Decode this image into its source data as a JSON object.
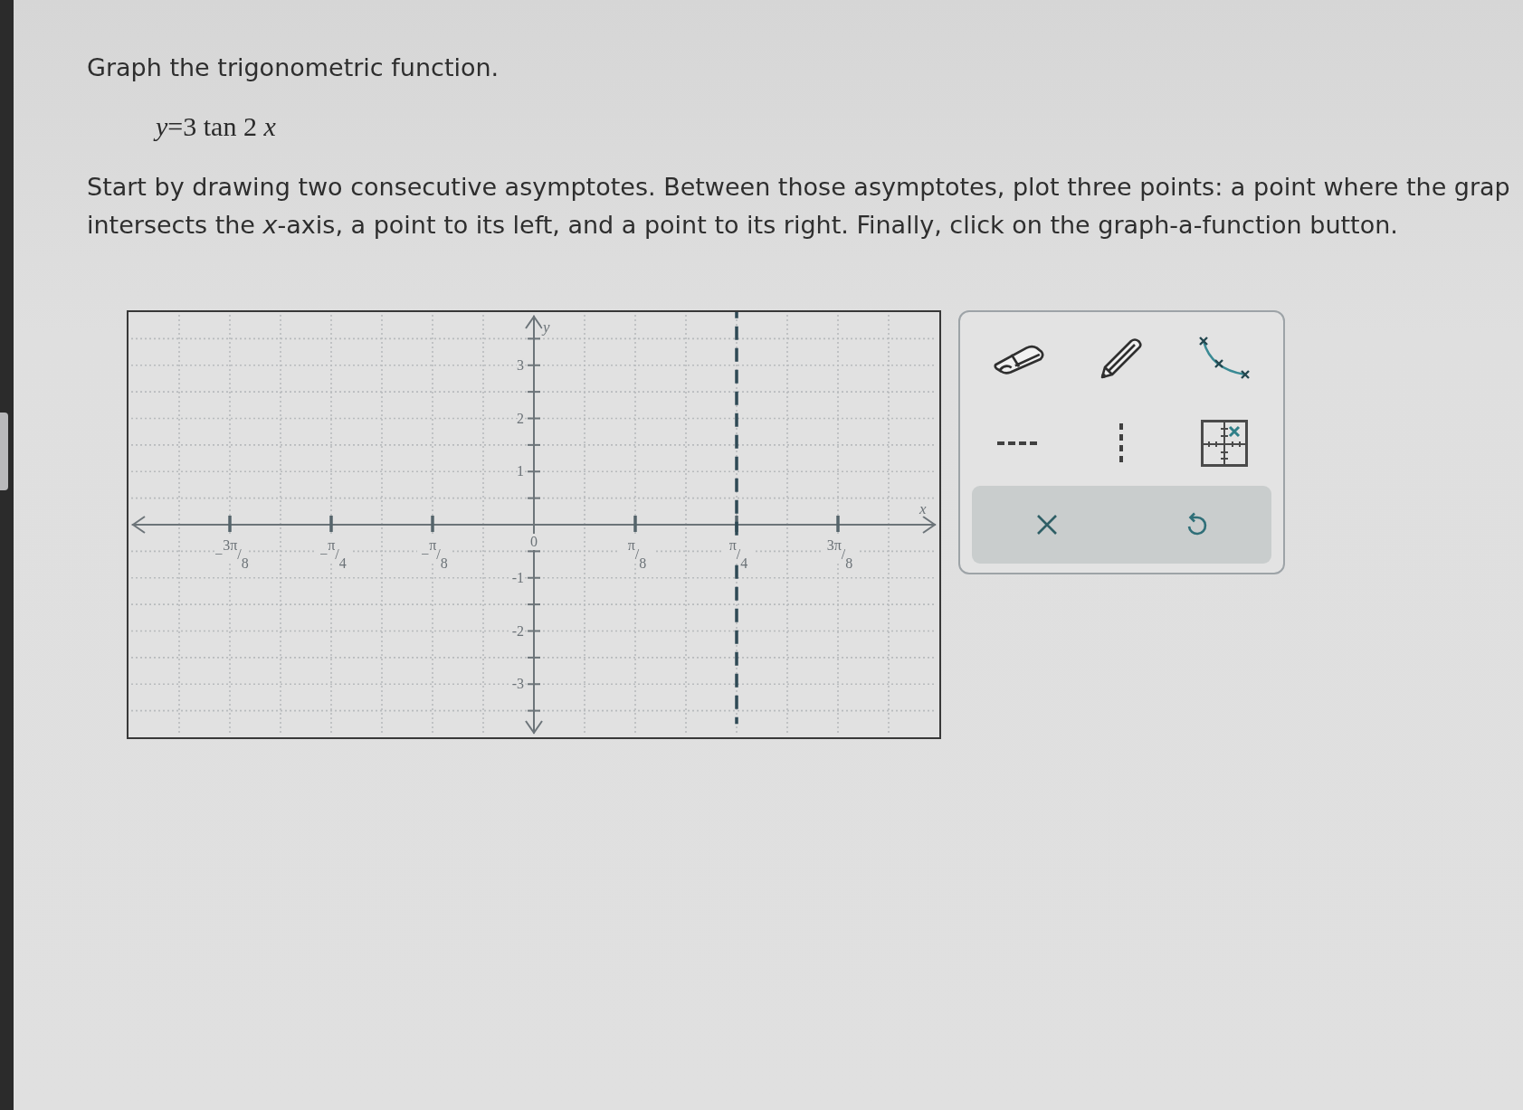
{
  "question": {
    "prompt": "Graph the trigonometric function.",
    "equation": "*y*=3 tan 2 *x*",
    "instructions": "Start by drawing two consecutive asymptotes. Between those asymptotes, plot three points: a point where the grap\nintersects the *x*-axis, a point to its left, and a point to its right. Finally, click on the graph-a-function button."
  },
  "graph": {
    "chart_data": {
      "type": "line",
      "xlabel": "x",
      "ylabel": "y",
      "xlim": [
        -1.5708,
        1.5708
      ],
      "ylim": [
        -4,
        4
      ],
      "grid": true,
      "line_style": "dashed",
      "xticks": [
        {
          "value": -1.1781,
          "label": "−3π/8"
        },
        {
          "value": -0.7854,
          "label": "−π/4"
        },
        {
          "value": -0.3927,
          "label": "−π/8"
        },
        {
          "value": 0,
          "label": "0"
        },
        {
          "value": 0.3927,
          "label": "π/8"
        },
        {
          "value": 0.7854,
          "label": "π/4"
        },
        {
          "value": 1.1781,
          "label": "3π/8"
        }
      ],
      "yticks": [
        {
          "value": -3,
          "label": "-3"
        },
        {
          "value": -2,
          "label": "-2"
        },
        {
          "value": -1,
          "label": "-1"
        },
        {
          "value": 1,
          "label": "1"
        },
        {
          "value": 2,
          "label": "2"
        },
        {
          "value": 3,
          "label": "3"
        }
      ],
      "series": [
        {
          "color": "#2f4a55",
          "x": [
            0.7854,
            0.7854
          ],
          "values": [
            4,
            -3.75
          ]
        }
      ]
    }
  },
  "toolbar": {
    "tools": [
      {
        "kind": "eraser"
      },
      {
        "kind": "pencil"
      },
      {
        "kind": "curve"
      },
      {
        "kind": "horizontal_line"
      },
      {
        "kind": "vertical_line"
      },
      {
        "kind": "point"
      }
    ],
    "actions": [
      {
        "kind": "clear"
      },
      {
        "kind": "undo"
      }
    ]
  }
}
